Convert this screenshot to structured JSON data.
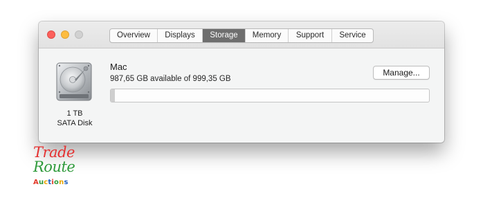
{
  "window": {
    "title_buttons": [
      "close",
      "minimize",
      "zoom"
    ]
  },
  "tabs": [
    {
      "label": "Overview",
      "active": false
    },
    {
      "label": "Displays",
      "active": false
    },
    {
      "label": "Storage",
      "active": true
    },
    {
      "label": "Memory",
      "active": false
    },
    {
      "label": "Support",
      "active": false
    },
    {
      "label": "Service",
      "active": false
    }
  ],
  "disk": {
    "icon": "hard-drive-icon",
    "size": "1 TB",
    "type": "SATA Disk"
  },
  "volume": {
    "name": "Mac",
    "availability": "987,65 GB available of 999,35 GB",
    "used_fraction": 0.012,
    "manage_label": "Manage..."
  },
  "watermark": {
    "line1": "Trade",
    "line2": "Route",
    "line3": "Auctions"
  },
  "colors": {
    "close": "#fc605c",
    "minimize": "#fdbc40",
    "zoom_disabled": "#d1d1d1",
    "active_tab": "#6e6e6e"
  }
}
